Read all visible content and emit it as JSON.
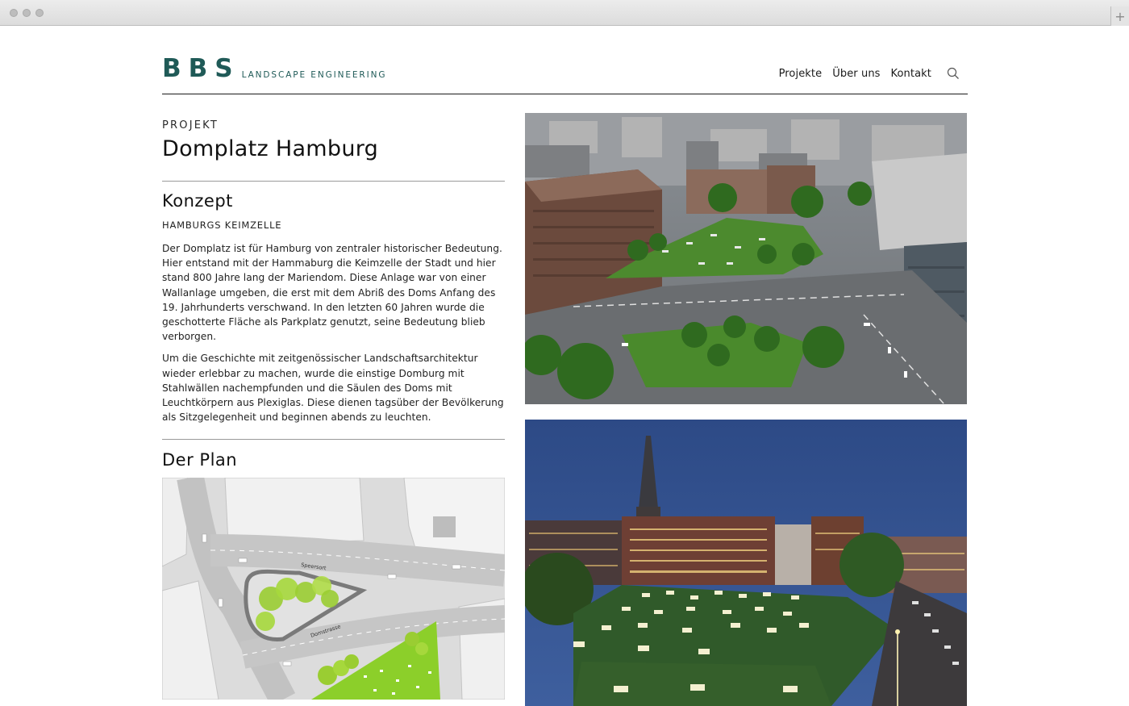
{
  "header": {
    "logo_mark": "BBS",
    "logo_sub": "LANDSCAPE ENGINEERING",
    "nav": [
      "Projekte",
      "Über uns",
      "Kontakt"
    ]
  },
  "project": {
    "eyebrow": "PROJEKT",
    "title": "Domplatz Hamburg"
  },
  "konzept": {
    "heading": "Konzept",
    "subheading": "HAMBURGS KEIMZELLE",
    "paragraphs": [
      "Der Domplatz ist für Hamburg von zentraler historischer Bedeutung. Hier entstand mit der Hammaburg die Keimzelle der Stadt und hier stand 800 Jahre lang der Mariendom. Diese Anlage war von einer Wallanlage umgeben, die erst mit dem Abriß des Doms Anfang des 19. Jahrhunderts verschwand. In den letzten 60 Jahren wurde die geschotterte Fläche als Parkplatz genutzt, seine Bedeutung blieb verborgen.",
      "Um die Geschichte mit zeitgenössischer Landschaftsarchitektur wieder erlebbar zu machen, wurde die einstige Domburg mit Stahlwällen nachempfunden und die Säulen des Doms mit Leuchtkörpern aus Plexiglas. Diese dienen tagsüber der Bevölkerung als Sitzgelegenheit und beginnen abends zu leuchten."
    ]
  },
  "plan": {
    "heading": "Der Plan",
    "street_labels": [
      "Speersort",
      "Domstrasse"
    ]
  },
  "colors": {
    "brand": "#1f5a57",
    "text": "#1a1a1a",
    "rule": "#9a9a9a"
  }
}
